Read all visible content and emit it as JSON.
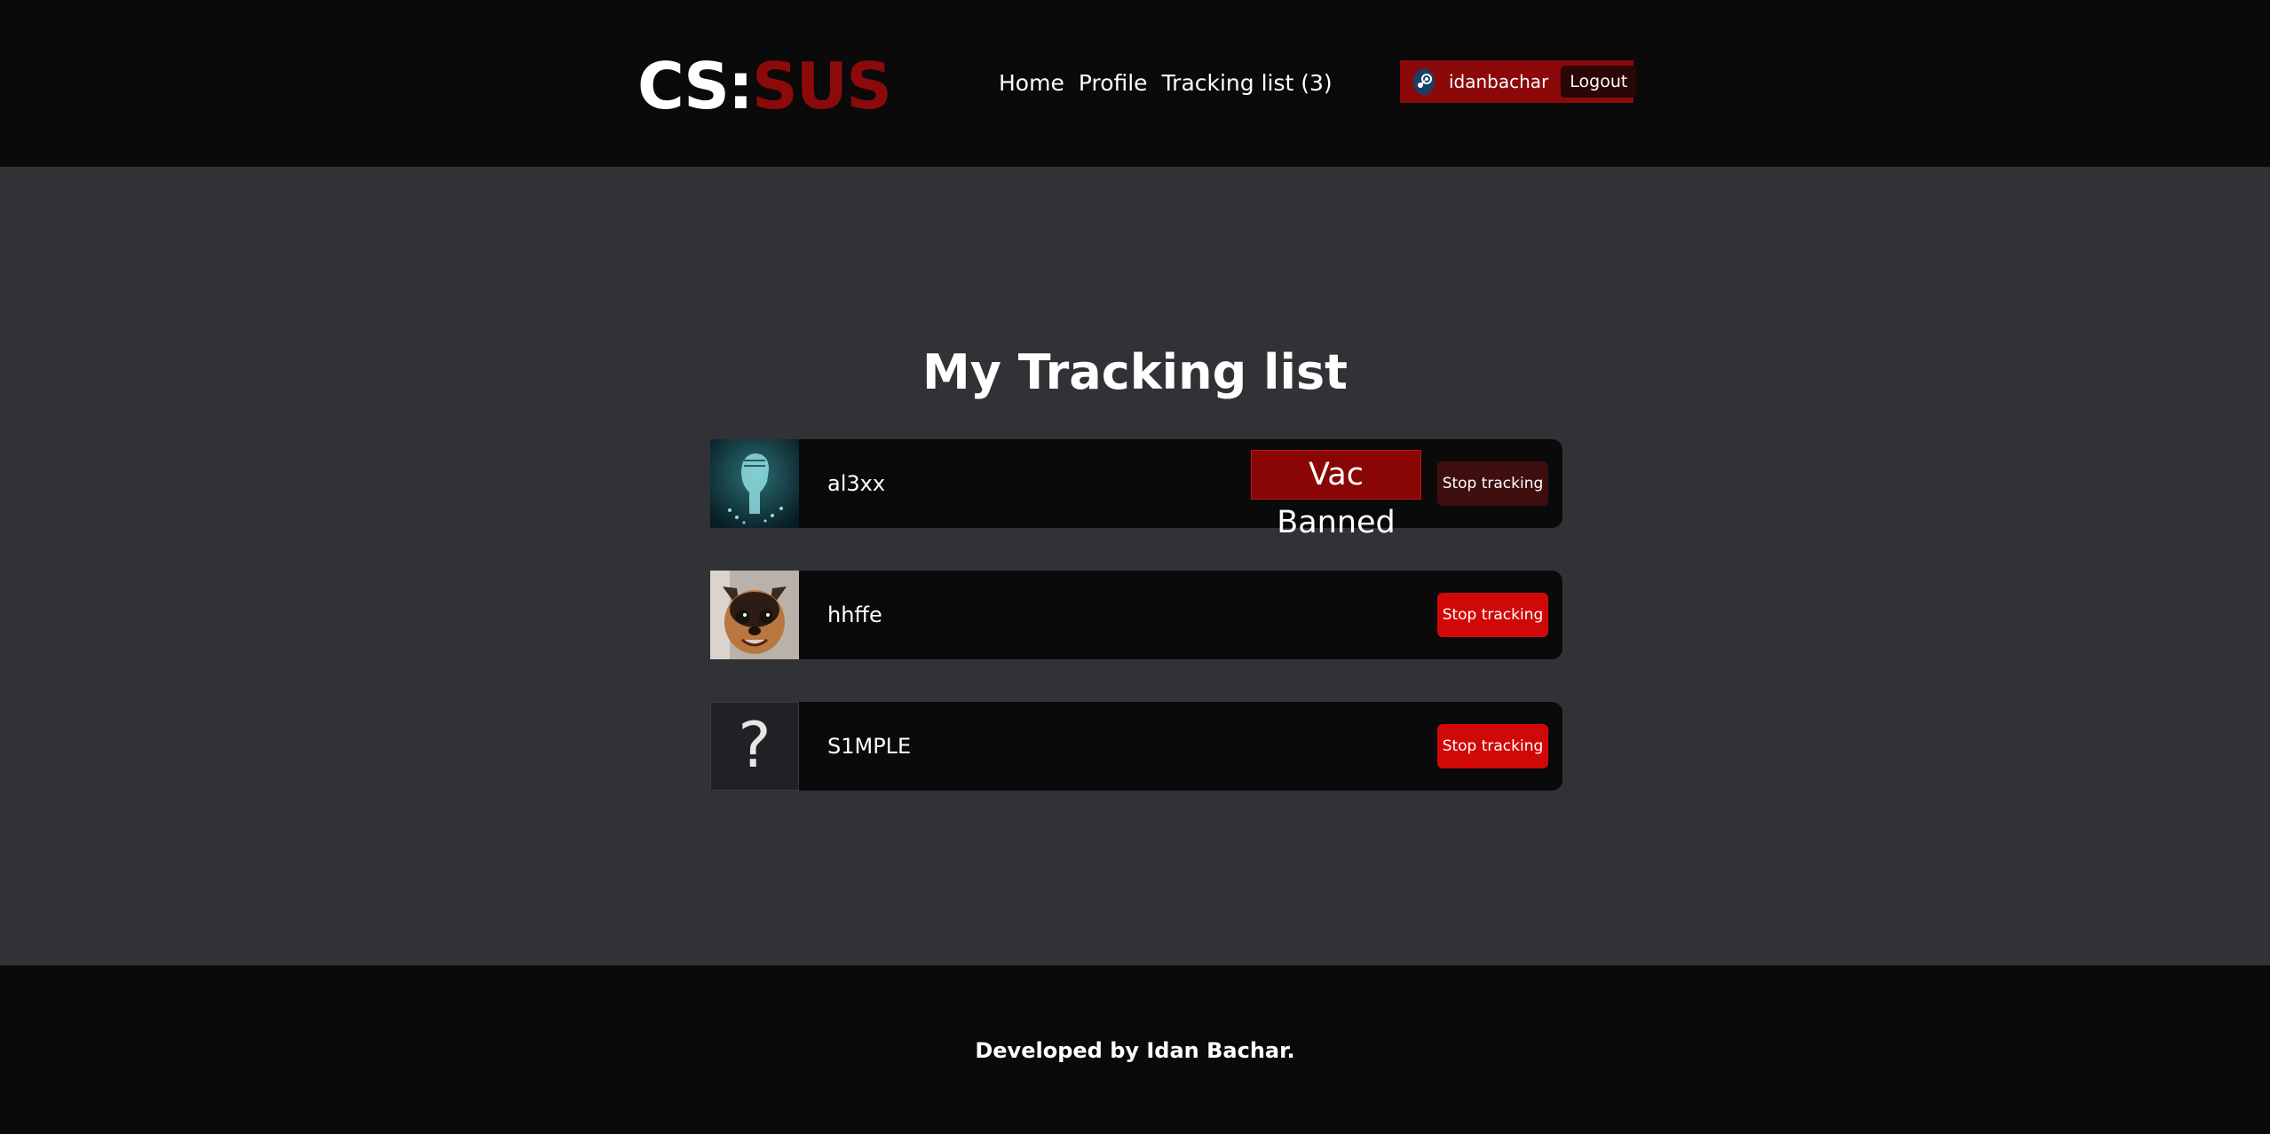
{
  "header": {
    "logo": {
      "part1": "CS:",
      "part2": "SUS"
    },
    "nav": [
      {
        "label": "Home"
      },
      {
        "label": "Profile"
      },
      {
        "label": "Tracking list (3)"
      }
    ],
    "user": {
      "name": "idanbachar",
      "logout_label": "Logout",
      "icon": "steam-icon"
    }
  },
  "main": {
    "title": "My Tracking list",
    "players": [
      {
        "name": "al3xx",
        "badge": "Vac Banned",
        "action_label": "Stop tracking",
        "avatar": "fist-avatar"
      },
      {
        "name": "hhffe",
        "action_label": "Stop tracking",
        "avatar": "dog-avatar"
      },
      {
        "name": "S1MPLE",
        "action_label": "Stop tracking",
        "avatar": "question-mark-avatar",
        "avatar_glyph": "?"
      }
    ]
  },
  "footer": {
    "text": "Developed by Idan Bachar."
  },
  "colors": {
    "header_bg": "#0a0a0a",
    "page_bg": "#313236",
    "accent_red": "#8b0909",
    "button_red": "#d10808",
    "button_dark_red": "#3f0f0f"
  }
}
